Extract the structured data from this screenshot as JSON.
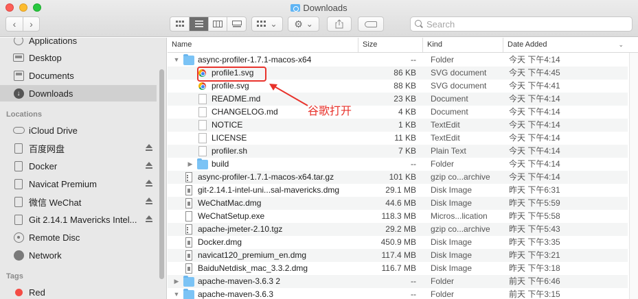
{
  "window": {
    "title": "Downloads"
  },
  "toolbar": {
    "back_label": "‹",
    "forward_label": "›",
    "search_placeholder": "Search"
  },
  "sidebar": {
    "favorites": [
      {
        "label": "Applications",
        "icon": "applications-icon"
      },
      {
        "label": "Desktop",
        "icon": "desktop-icon"
      },
      {
        "label": "Documents",
        "icon": "documents-icon"
      },
      {
        "label": "Downloads",
        "icon": "downloads-icon",
        "selected": true
      }
    ],
    "locations_header": "Locations",
    "locations": [
      {
        "label": "iCloud Drive",
        "icon": "cloud-icon"
      },
      {
        "label": "百度网盘",
        "icon": "drive-icon",
        "eject": true
      },
      {
        "label": "Docker",
        "icon": "drive-icon",
        "eject": true
      },
      {
        "label": "Navicat Premium",
        "icon": "drive-icon",
        "eject": true
      },
      {
        "label": "微信 WeChat",
        "icon": "drive-icon",
        "eject": true
      },
      {
        "label": "Git 2.14.1 Mavericks Intel...",
        "icon": "drive-icon",
        "eject": true
      },
      {
        "label": "Remote Disc",
        "icon": "disc-icon"
      },
      {
        "label": "Network",
        "icon": "globe-icon"
      }
    ],
    "tags_header": "Tags",
    "tags": [
      {
        "label": "Red",
        "color": "#f44c45"
      }
    ]
  },
  "columns": {
    "name": "Name",
    "size": "Size",
    "kind": "Kind",
    "date": "Date Added"
  },
  "files": [
    {
      "name": "async-profiler-1.7.1-macos-x64",
      "size": "--",
      "kind": "Folder",
      "date": "今天 下午4:14",
      "icon": "folder-icon",
      "indent": 0,
      "disclosure": "▼"
    },
    {
      "name": "profile1.svg",
      "size": "86 KB",
      "kind": "SVG document",
      "date": "今天 下午4:45",
      "icon": "chrome-icon",
      "indent": 1,
      "disclosure": ""
    },
    {
      "name": "profile.svg",
      "size": "88 KB",
      "kind": "SVG document",
      "date": "今天 下午4:41",
      "icon": "chrome-icon",
      "indent": 1,
      "disclosure": ""
    },
    {
      "name": "README.md",
      "size": "23 KB",
      "kind": "Document",
      "date": "今天 下午4:14",
      "icon": "document-icon",
      "indent": 1,
      "disclosure": ""
    },
    {
      "name": "CHANGELOG.md",
      "size": "4 KB",
      "kind": "Document",
      "date": "今天 下午4:14",
      "icon": "document-icon",
      "indent": 1,
      "disclosure": ""
    },
    {
      "name": "NOTICE",
      "size": "1 KB",
      "kind": "TextEdit",
      "date": "今天 下午4:14",
      "icon": "document-icon",
      "indent": 1,
      "disclosure": ""
    },
    {
      "name": "LICENSE",
      "size": "11 KB",
      "kind": "TextEdit",
      "date": "今天 下午4:14",
      "icon": "document-icon",
      "indent": 1,
      "disclosure": ""
    },
    {
      "name": "profiler.sh",
      "size": "7 KB",
      "kind": "Plain Text",
      "date": "今天 下午4:14",
      "icon": "document-icon",
      "indent": 1,
      "disclosure": ""
    },
    {
      "name": "build",
      "size": "--",
      "kind": "Folder",
      "date": "今天 下午4:14",
      "icon": "folder-icon",
      "indent": 1,
      "disclosure": "▶"
    },
    {
      "name": "async-profiler-1.7.1-macos-x64.tar.gz",
      "size": "101 KB",
      "kind": "gzip co...archive",
      "date": "今天 下午4:14",
      "icon": "archive-icon",
      "indent": 0,
      "disclosure": ""
    },
    {
      "name": "git-2.14.1-intel-uni...sal-mavericks.dmg",
      "size": "29.1 MB",
      "kind": "Disk Image",
      "date": "昨天 下午6:31",
      "icon": "disk-image-icon",
      "indent": 0,
      "disclosure": ""
    },
    {
      "name": "WeChatMac.dmg",
      "size": "44.6 MB",
      "kind": "Disk Image",
      "date": "昨天 下午5:59",
      "icon": "disk-image-icon",
      "indent": 0,
      "disclosure": ""
    },
    {
      "name": "WeChatSetup.exe",
      "size": "118.3 MB",
      "kind": "Micros...lication",
      "date": "昨天 下午5:58",
      "icon": "file-icon",
      "indent": 0,
      "disclosure": ""
    },
    {
      "name": "apache-jmeter-2.10.tgz",
      "size": "29.2 MB",
      "kind": "gzip co...archive",
      "date": "昨天 下午5:43",
      "icon": "archive-icon",
      "indent": 0,
      "disclosure": ""
    },
    {
      "name": "Docker.dmg",
      "size": "450.9 MB",
      "kind": "Disk Image",
      "date": "昨天 下午3:35",
      "icon": "disk-image-icon",
      "indent": 0,
      "disclosure": ""
    },
    {
      "name": "navicat120_premium_en.dmg",
      "size": "117.4 MB",
      "kind": "Disk Image",
      "date": "昨天 下午3:21",
      "icon": "disk-image-icon",
      "indent": 0,
      "disclosure": ""
    },
    {
      "name": "BaiduNetdisk_mac_3.3.2.dmg",
      "size": "116.7 MB",
      "kind": "Disk Image",
      "date": "昨天 下午3:18",
      "icon": "disk-image-icon",
      "indent": 0,
      "disclosure": ""
    },
    {
      "name": "apache-maven-3.6.3 2",
      "size": "--",
      "kind": "Folder",
      "date": "前天 下午6:46",
      "icon": "folder-icon",
      "indent": 0,
      "disclosure": "▶"
    },
    {
      "name": "apache-maven-3.6.3",
      "size": "--",
      "kind": "Folder",
      "date": "前天 下午3:15",
      "icon": "folder-icon",
      "indent": 0,
      "disclosure": "▼"
    }
  ],
  "annotation": {
    "text": "谷歌打开",
    "color": "#e8322b"
  }
}
